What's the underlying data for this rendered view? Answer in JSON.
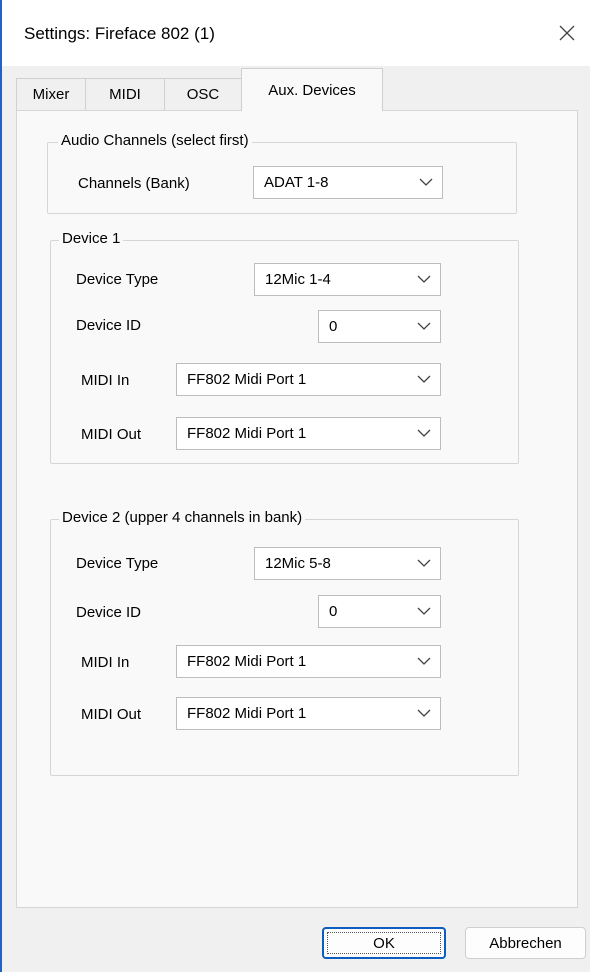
{
  "window": {
    "title": "Settings: Fireface 802 (1)"
  },
  "tabs": [
    {
      "label": "Mixer"
    },
    {
      "label": "MIDI"
    },
    {
      "label": "OSC"
    },
    {
      "label": "Aux. Devices",
      "active": true
    }
  ],
  "audio_channels": {
    "title": "Audio Channels (select first)",
    "label": "Channels (Bank)",
    "value": "ADAT 1-8"
  },
  "device1": {
    "title": "Device 1",
    "type_label": "Device Type",
    "type_value": "12Mic 1-4",
    "id_label": "Device ID",
    "id_value": "0",
    "midi_in_label": "MIDI In",
    "midi_in_value": "FF802 Midi Port 1",
    "midi_out_label": "MIDI Out",
    "midi_out_value": "FF802 Midi Port 1"
  },
  "device2": {
    "title": "Device 2 (upper 4 channels in bank)",
    "type_label": "Device Type",
    "type_value": "12Mic 5-8",
    "id_label": "Device ID",
    "id_value": "0",
    "midi_in_label": "MIDI In",
    "midi_in_value": "FF802 Midi Port 1",
    "midi_out_label": "MIDI Out",
    "midi_out_value": "FF802 Midi Port 1"
  },
  "buttons": {
    "ok": "OK",
    "cancel": "Abbrechen"
  },
  "colors": {
    "accent": "#1f63c6",
    "window_bg": "#f0f0f0",
    "panel_bg": "#f9f9f9"
  },
  "icons": {
    "close": "close-icon",
    "dropdown": "chevron-down-icon"
  }
}
